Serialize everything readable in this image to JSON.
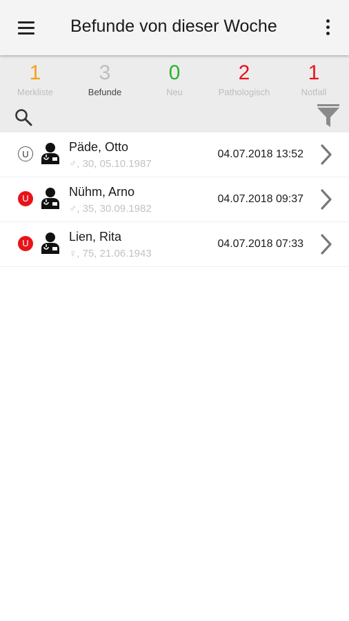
{
  "header": {
    "title": "Befunde von dieser Woche",
    "menu_icon": "hamburger-menu-icon",
    "more_icon": "more-vertical-icon"
  },
  "stats": [
    {
      "count": "1",
      "label": "Merkliste",
      "color": "#f5a01a"
    },
    {
      "count": "3",
      "label": "Befunde",
      "color": "#bdbdbd"
    },
    {
      "count": "0",
      "label": "Neu",
      "color": "#2bb32b"
    },
    {
      "count": "2",
      "label": "Pathologisch",
      "color": "#e8131b"
    },
    {
      "count": "1",
      "label": "Notfall",
      "color": "#e8131b"
    }
  ],
  "toolbar": {
    "search_icon": "search-icon",
    "filter_icon": "filter-icon"
  },
  "results": [
    {
      "badge": "U",
      "badge_style": "outline",
      "name": "Päde, Otto",
      "details": "♂, 30, 05.10.1987",
      "datetime": "04.07.2018 13:52"
    },
    {
      "badge": "U",
      "badge_style": "filled",
      "name": "Nühm, Arno",
      "details": "♂, 35, 30.09.1982",
      "datetime": "04.07.2018 09:37"
    },
    {
      "badge": "U",
      "badge_style": "filled",
      "name": "Lien, Rita",
      "details": "♀, 75, 21.06.1943",
      "datetime": "04.07.2018 07:33"
    }
  ],
  "colors": {
    "appbar_bg": "#f4f4f4",
    "stats_bg": "#ececec",
    "badge_red": "#e8131b"
  }
}
